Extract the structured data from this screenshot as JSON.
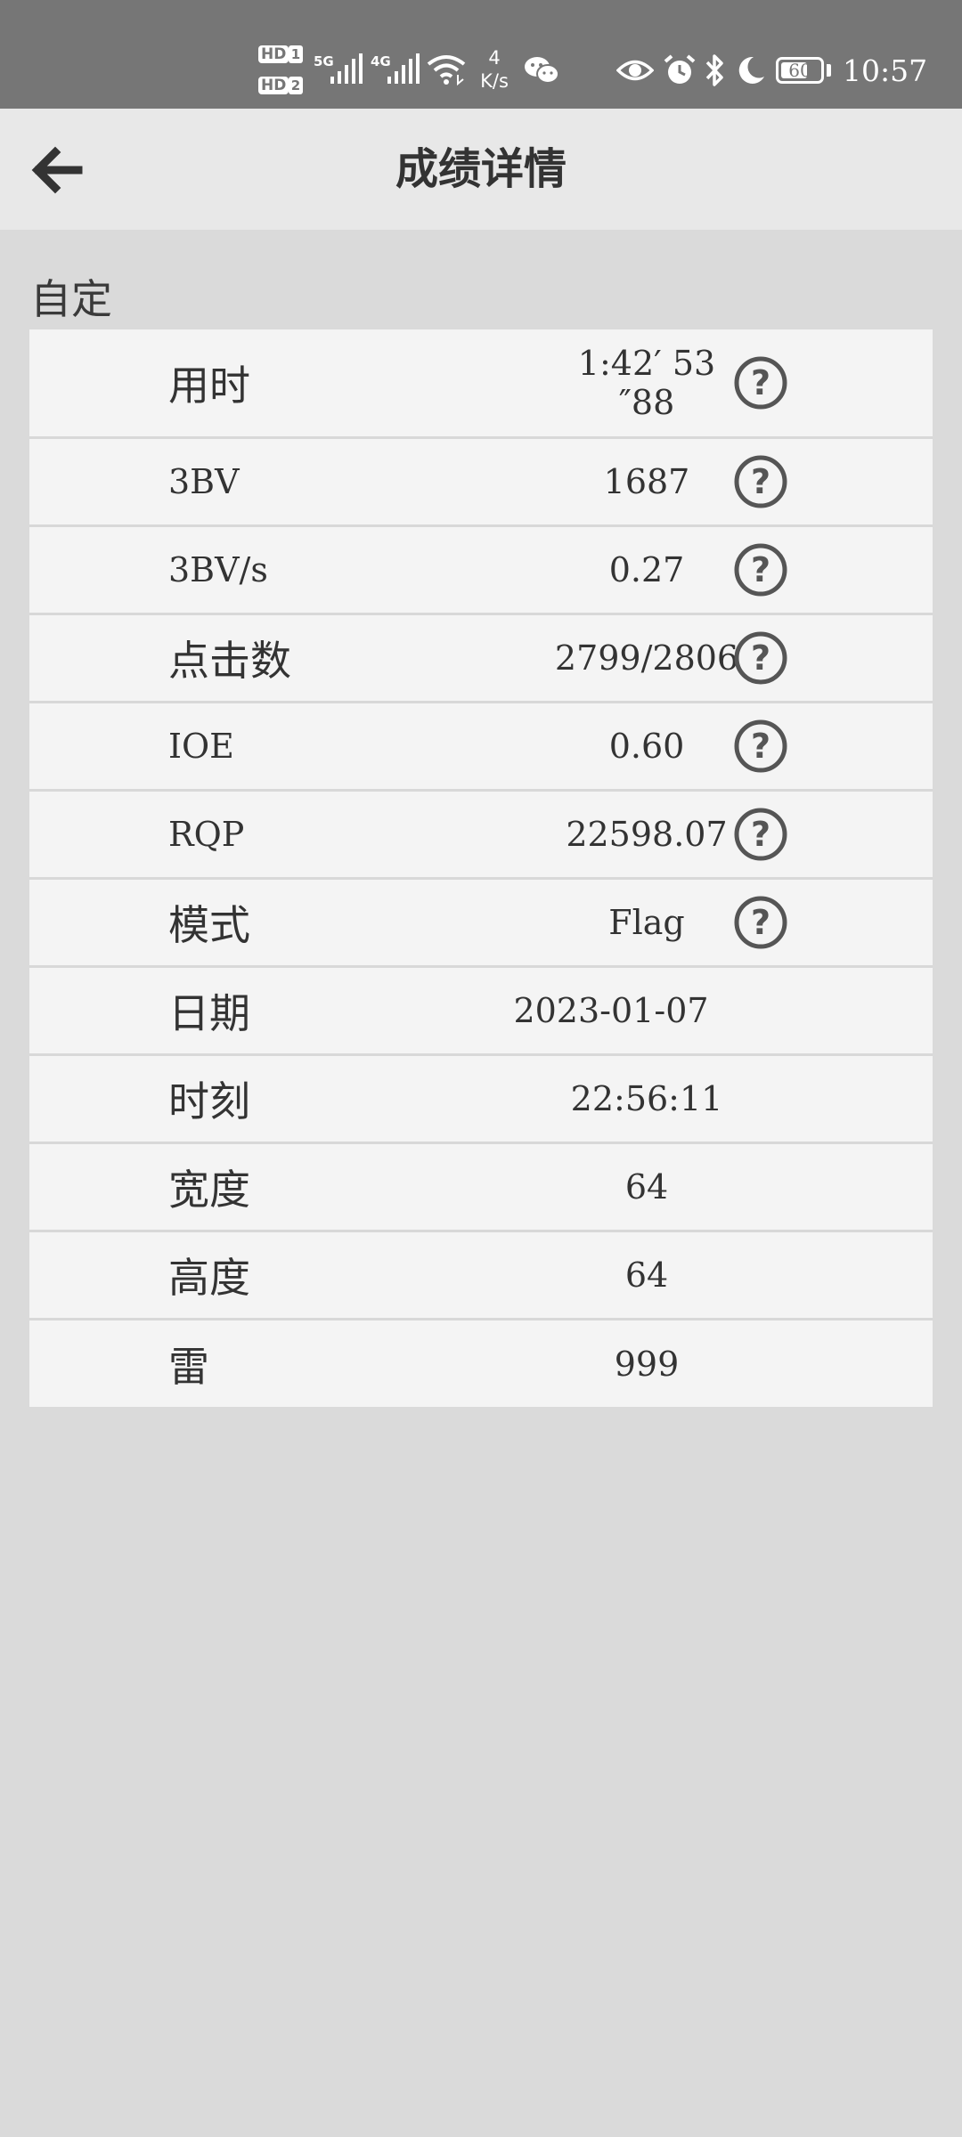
{
  "status_bar": {
    "hd1": "HD",
    "sim1": "1",
    "hd2": "HD",
    "sim2": "2",
    "net1": "5G",
    "net2": "4G",
    "speed_value": "4",
    "speed_unit": "K/s",
    "battery": "60",
    "time": "10:57"
  },
  "header": {
    "title": "成绩详情"
  },
  "section": {
    "label": "自定"
  },
  "rows": [
    {
      "label": "用时",
      "value": "1:42′ 53\n″88",
      "has_help": true
    },
    {
      "label": "3BV",
      "value": "1687",
      "has_help": true
    },
    {
      "label": "3BV/s",
      "value": "0.27",
      "has_help": true
    },
    {
      "label": "点击数",
      "value": "2799/2806",
      "has_help": true
    },
    {
      "label": "IOE",
      "value": "0.60",
      "has_help": true
    },
    {
      "label": "RQP",
      "value": "22598.07",
      "has_help": true
    },
    {
      "label": "模式",
      "value": "Flag",
      "has_help": true
    },
    {
      "label": "日期",
      "value": "2023-01-07",
      "has_help": false
    },
    {
      "label": "时刻",
      "value": "22:56:11",
      "has_help": false
    },
    {
      "label": "宽度",
      "value": "64",
      "has_help": false
    },
    {
      "label": "高度",
      "value": "64",
      "has_help": false
    },
    {
      "label": "雷",
      "value": "999",
      "has_help": false
    }
  ],
  "colors": {
    "status_bar": "#767676",
    "header": "#e8e8e8",
    "background": "#dadada",
    "row": "#f4f4f4",
    "text": "#333333"
  },
  "icons": [
    "back-arrow-icon",
    "help-icon",
    "signal-icon",
    "wifi-icon",
    "wechat-icon",
    "eye-icon",
    "alarm-icon",
    "bluetooth-icon",
    "moon-icon",
    "battery-icon"
  ]
}
